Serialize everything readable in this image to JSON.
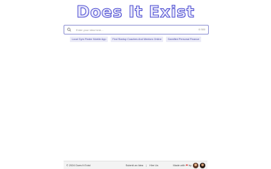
{
  "app": {
    "title": "Does It Exist"
  },
  "search": {
    "placeholder": "Enter your idea here...",
    "counter": "0/ 500"
  },
  "suggestions": [
    "Local Gym Finder Mobile App",
    "Find Startup Coaches And Mentors Online",
    "Gamified Personal Finance"
  ],
  "footer": {
    "copyright": "© 2024 Does It Exist",
    "submit_link": "Submit an Idea",
    "separator": "|",
    "hire_link": "Hire Us",
    "made_with": "Made with",
    "by": "by",
    "heart_color": "#d93232"
  },
  "colors": {
    "accent": "#4b4bd1",
    "chip_bg": "#ececf8",
    "chip_text": "#4a4aa8"
  }
}
